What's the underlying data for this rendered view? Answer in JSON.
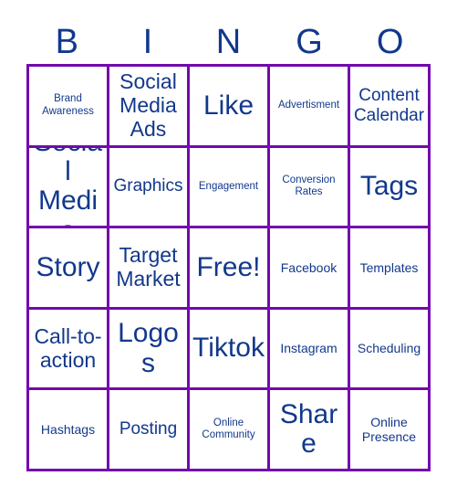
{
  "header": {
    "letters": [
      "B",
      "I",
      "N",
      "G",
      "O"
    ],
    "letter_color": "#12388c"
  },
  "style": {
    "border_color": "#7209ad",
    "text_color": "#12388c",
    "background": "#ffffff"
  },
  "grid": {
    "rows": 5,
    "columns": 5,
    "cells": [
      {
        "label": "Brand Awareness",
        "size": "xs"
      },
      {
        "label": "Social Media Ads",
        "size": "l"
      },
      {
        "label": "Like",
        "size": "xl"
      },
      {
        "label": "Advertisment",
        "size": "xs"
      },
      {
        "label": "Content Calendar",
        "size": "m"
      },
      {
        "label": "Social Media",
        "size": "xl"
      },
      {
        "label": "Graphics",
        "size": "m"
      },
      {
        "label": "Engagement",
        "size": "xs"
      },
      {
        "label": "Conversion Rates",
        "size": "xs"
      },
      {
        "label": "Tags",
        "size": "xl"
      },
      {
        "label": "Story",
        "size": "xl"
      },
      {
        "label": "Target Market",
        "size": "l"
      },
      {
        "label": "Free!",
        "size": "xl"
      },
      {
        "label": "Facebook",
        "size": "s"
      },
      {
        "label": "Templates",
        "size": "s"
      },
      {
        "label": "Call-to-action",
        "size": "l"
      },
      {
        "label": "Logos",
        "size": "xl"
      },
      {
        "label": "Tiktok",
        "size": "xl"
      },
      {
        "label": "Instagram",
        "size": "s"
      },
      {
        "label": "Scheduling",
        "size": "s"
      },
      {
        "label": "Hashtags",
        "size": "s"
      },
      {
        "label": "Posting",
        "size": "m"
      },
      {
        "label": "Online Community",
        "size": "xs"
      },
      {
        "label": "Share",
        "size": "xl"
      },
      {
        "label": "Online Presence",
        "size": "s"
      }
    ]
  }
}
